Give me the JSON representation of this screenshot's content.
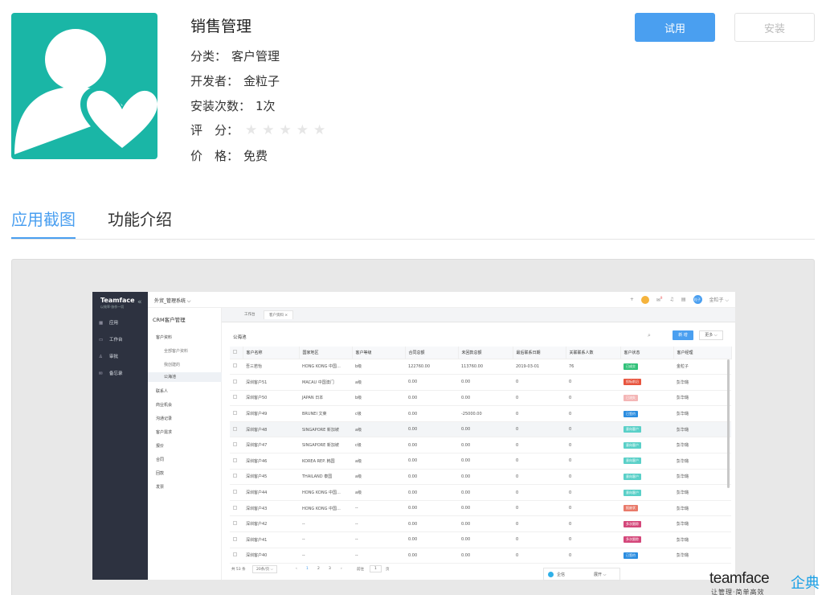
{
  "app": {
    "name": "销售管理",
    "category_label": "分类：",
    "category": "客户管理",
    "developer_label": "开发者：",
    "developer": "金粒子",
    "installs_label": "安装次数：",
    "installs": "1次",
    "rating_label": "评　分：",
    "rating": 0,
    "rating_max": 5,
    "stars": "★★★★★",
    "price_label": "价　格：",
    "price": "免费",
    "icon": "user-heart-icon",
    "icon_color": "#1ab6a6"
  },
  "actions": {
    "try_label": "试用",
    "install_label": "安装",
    "accent": "#4a9ff0"
  },
  "tabs": [
    {
      "label": "应用截图",
      "active": true
    },
    {
      "label": "功能介绍",
      "active": false
    }
  ],
  "screenshot": {
    "brand": "Teamface",
    "brand_sub": "以效率·协作一切",
    "system": "外贸_管理系统 ⌵",
    "nav": [
      {
        "icon": "app-grid-icon",
        "label": "应用"
      },
      {
        "icon": "desk-icon",
        "label": "工作台"
      },
      {
        "icon": "user-icon",
        "label": "审批"
      },
      {
        "icon": "mail-icon",
        "label": "备忘录"
      }
    ],
    "topbar": {
      "plus": "+",
      "badge_count": "9",
      "user": "金粒子 ⌵",
      "avatar": "粒子"
    },
    "menu_title": "CRM客户管理",
    "menu": [
      {
        "label": "客户资料",
        "type": "group"
      },
      {
        "label": "全部客户资料",
        "type": "sub"
      },
      {
        "label": "我创建的",
        "type": "sub"
      },
      {
        "label": "公海池",
        "type": "selected"
      },
      {
        "label": "联系人",
        "type": "item"
      },
      {
        "label": "商业机会",
        "type": "item"
      },
      {
        "label": "沟通记录",
        "type": "item"
      },
      {
        "label": "客户需求",
        "type": "item"
      },
      {
        "label": "报价",
        "type": "item"
      },
      {
        "label": "合同",
        "type": "item"
      },
      {
        "label": "回款",
        "type": "item"
      },
      {
        "label": "发票",
        "type": "item"
      }
    ],
    "tabs": [
      "工作台",
      "客户资料 ×"
    ],
    "list_title": "公海池",
    "new_label": "新 增",
    "more_label": "更多 ⌵",
    "columns": [
      "客户名称",
      "国家地区",
      "客户等级",
      "合同总额",
      "未回款总额",
      "最后联系日期",
      "关联联系人数",
      "客户状态",
      "客户经理"
    ],
    "rows": [
      [
        "吾三若怡",
        "HONG KONG 中国...",
        "b级",
        "122760.00",
        "113760.00",
        "2019-03-01",
        "76",
        "已成交",
        "金粒子"
      ],
      [
        "深圳客户51",
        "MACAU 中国澳门",
        "a级",
        "0.00",
        "0.00",
        "0",
        "0",
        "投标前沿",
        "彭华璐"
      ],
      [
        "深圳客户50",
        "JAPAN 日本",
        "b级",
        "0.00",
        "0.00",
        "0",
        "0",
        "已流失",
        "彭华璐"
      ],
      [
        "深圳客户49",
        "BRUNEI 文莱",
        "c级",
        "0.00",
        "-25000.00",
        "0",
        "0",
        "已签约",
        "彭华璐"
      ],
      [
        "深圳客户48",
        "SINGAPORE 新加坡",
        "a级",
        "0.00",
        "0.00",
        "0",
        "0",
        "意向客户",
        "彭华璐"
      ],
      [
        "深圳客户47",
        "SINGAPORE 新加坡",
        "c级",
        "0.00",
        "0.00",
        "0",
        "0",
        "意向客户",
        "彭华璐"
      ],
      [
        "深圳客户46",
        "KOREA REP. 韩国",
        "a级",
        "0.00",
        "0.00",
        "0",
        "0",
        "意向客户",
        "彭华璐"
      ],
      [
        "深圳客户45",
        "THAILAND 泰国",
        "a级",
        "0.00",
        "0.00",
        "0",
        "0",
        "意向客户",
        "彭华璐"
      ],
      [
        "深圳客户44",
        "HONG KONG 中国...",
        "a级",
        "0.00",
        "0.00",
        "0",
        "0",
        "意向客户",
        "彭华璐"
      ],
      [
        "深圳客户43",
        "HONG KONG 中国...",
        "--",
        "0.00",
        "0.00",
        "0",
        "0",
        "报废状",
        "彭华璐"
      ],
      [
        "深圳客户42",
        "--",
        "--",
        "0.00",
        "0.00",
        "0",
        "0",
        "多次跟踪",
        "彭华璐"
      ],
      [
        "深圳客户41",
        "--",
        "--",
        "0.00",
        "0.00",
        "0",
        "0",
        "多次跟踪",
        "彭华璐"
      ],
      [
        "深圳客户40",
        "--",
        "--",
        "0.00",
        "0.00",
        "0",
        "0",
        "已签约",
        "彭华璐"
      ]
    ],
    "status_colors": {
      "已成交": "#33c27a",
      "投标前沿": "#e8553f",
      "已流失": "#f4b6b6",
      "已签约": "#2b8de0",
      "意向客户": "#5ad0c8",
      "报废状": "#e97a6a",
      "多次跟踪": "#d4477a"
    },
    "pager": {
      "total": "共 53 条",
      "size": "20条/页 ⌵",
      "prev": "‹",
      "pages": [
        "1",
        "2",
        "3"
      ],
      "next": "›",
      "goto": "前往",
      "page_input": "1",
      "page_unit": "页"
    },
    "chat": {
      "label": "企信",
      "expand": "展开 ⌵"
    }
  },
  "watermark": {
    "en": "teamface",
    "cn": "企典",
    "slogan": "让管理·简单高效"
  }
}
